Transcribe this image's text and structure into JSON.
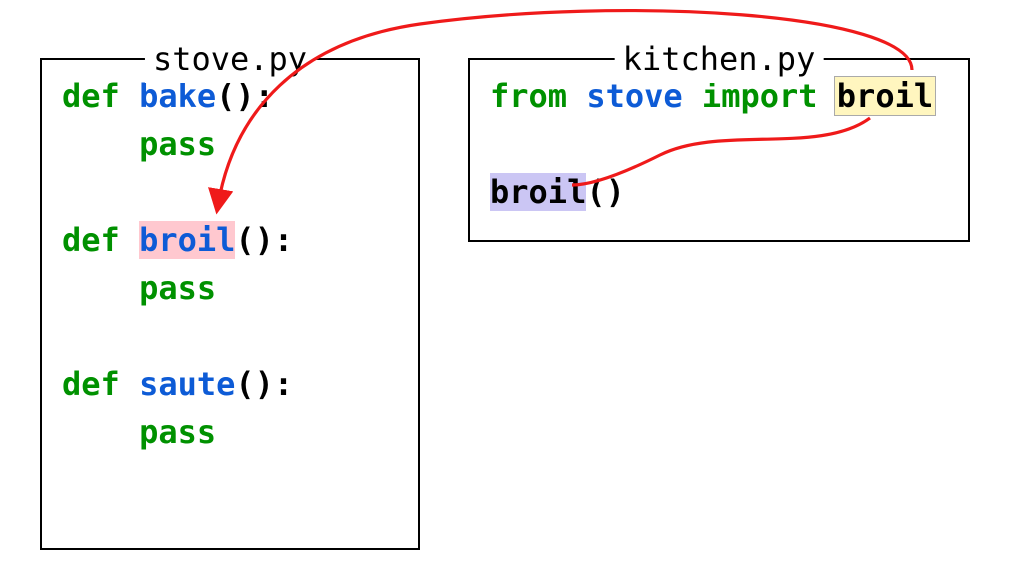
{
  "files": {
    "stove": {
      "title": "stove.py",
      "defs": [
        {
          "kw_def": "def",
          "name": "bake",
          "pass": "pass"
        },
        {
          "kw_def": "def",
          "name": "broil",
          "pass": "pass"
        },
        {
          "kw_def": "def",
          "name": "saute",
          "pass": "pass"
        }
      ]
    },
    "kitchen": {
      "title": "kitchen.py",
      "import_line": {
        "kw_from": "from",
        "module": "stove",
        "kw_import": "import",
        "symbol": "broil"
      },
      "call_line": {
        "fn": "broil",
        "suffix": "()"
      }
    }
  },
  "relations": [
    {
      "from": "kitchen.import.broil",
      "to": "stove.def.broil",
      "kind": "arrow"
    },
    {
      "from": "kitchen.import.broil",
      "to": "kitchen.call.broil",
      "kind": "tie"
    }
  ]
}
